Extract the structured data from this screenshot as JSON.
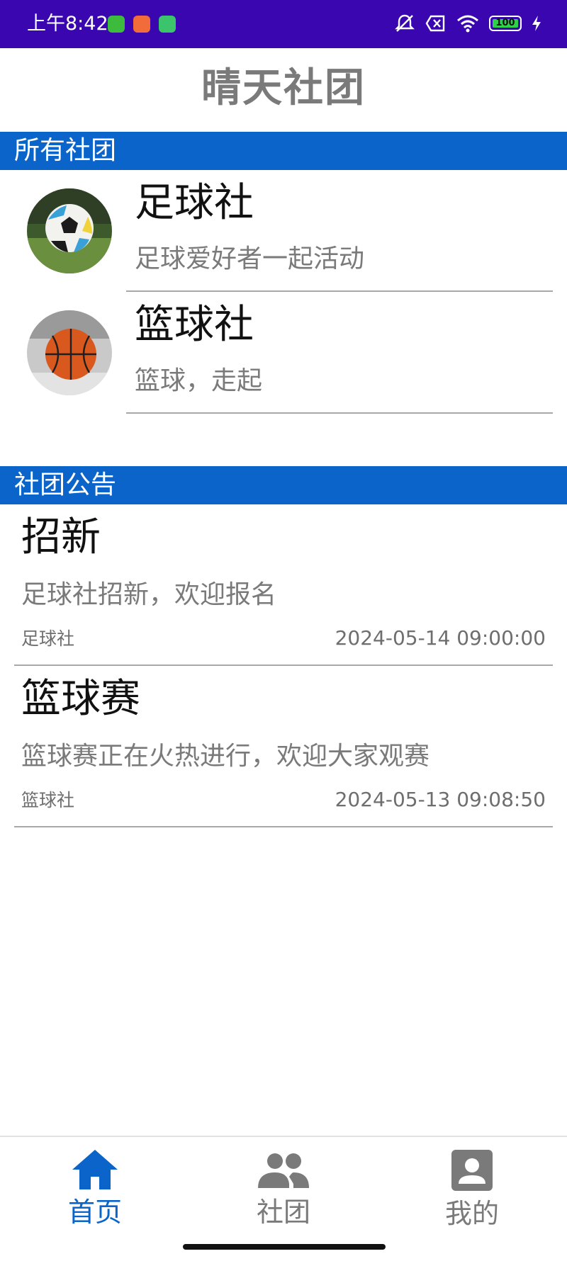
{
  "status_bar": {
    "time": "上午8:42",
    "battery": "100",
    "icons": [
      "notification-green-icon",
      "notification-orange-icon",
      "notification-tool-icon",
      "mute-icon",
      "data-off-icon",
      "wifi-icon",
      "battery-icon",
      "charging-icon"
    ]
  },
  "app": {
    "title": "晴天社团"
  },
  "clubs_section": {
    "header": "所有社团",
    "items": [
      {
        "name": "足球社",
        "desc": "足球爱好者一起活动",
        "image": "soccer-ball"
      },
      {
        "name": "篮球社",
        "desc": "篮球，走起",
        "image": "basketball"
      }
    ]
  },
  "notices_section": {
    "header": "社团公告",
    "items": [
      {
        "title": "招新",
        "content": "足球社招新，欢迎报名",
        "club": "足球社",
        "datetime": "2024-05-14 09:00:00"
      },
      {
        "title": "篮球赛",
        "content": "篮球赛正在火热进行，欢迎大家观赛",
        "club": "篮球社",
        "datetime": "2024-05-13 09:08:50"
      }
    ]
  },
  "bottom_nav": {
    "items": [
      {
        "label": "首页",
        "icon": "home-icon",
        "active": true
      },
      {
        "label": "社团",
        "icon": "group-icon",
        "active": false
      },
      {
        "label": "我的",
        "icon": "profile-icon",
        "active": false
      }
    ]
  },
  "colors": {
    "status_bar": "#3a06b0",
    "accent": "#0a64c9",
    "muted_text": "#7a7a7a"
  }
}
